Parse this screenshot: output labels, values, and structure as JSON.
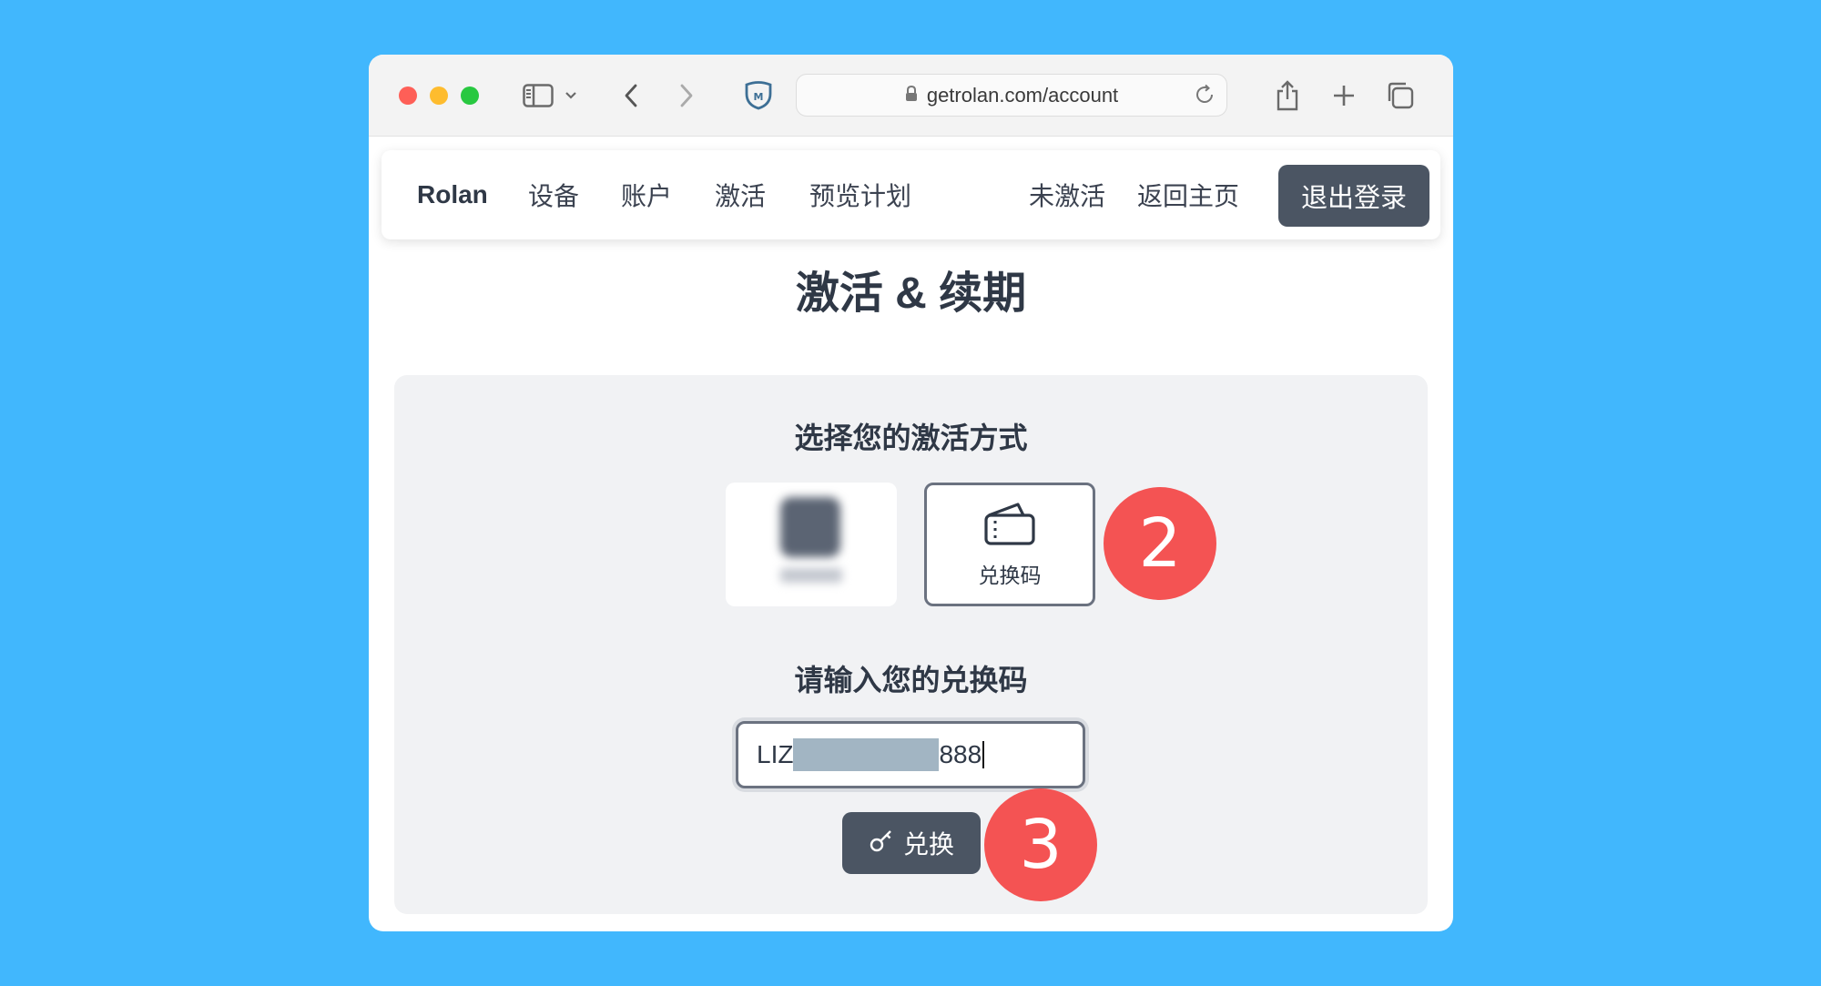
{
  "browser": {
    "url": "getrolan.com/account"
  },
  "navbar": {
    "brand": "Rolan",
    "items": [
      "设备",
      "账户",
      "激活",
      "预览计划"
    ],
    "status": "未激活",
    "home": "返回主页",
    "logout": "退出登录"
  },
  "page": {
    "title": "激活 & 续期",
    "method_heading": "选择您的激活方式",
    "methods": [
      "兑换码"
    ],
    "code_heading": "请输入您的兑换码",
    "code_prefix": "LIZ",
    "code_suffix": "888",
    "redeem_label": "兑换"
  },
  "annotations": {
    "step2": "2",
    "step3": "3"
  },
  "colors": {
    "background": "#41b7fd",
    "dark_button": "#4b5563",
    "badge": "#f45353",
    "traffic_red": "#fe5f57",
    "traffic_yellow": "#febc2e",
    "traffic_green": "#28c840"
  }
}
